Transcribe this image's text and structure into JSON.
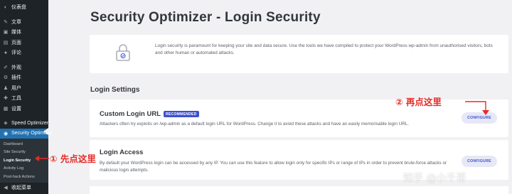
{
  "sidebar": {
    "top_items": [
      {
        "label": "仪表盘",
        "icon": "dashboard-icon"
      },
      {
        "label": "文章",
        "icon": "pin-icon"
      },
      {
        "label": "媒体",
        "icon": "media-icon"
      },
      {
        "label": "页面",
        "icon": "page-icon"
      },
      {
        "label": "评论",
        "icon": "comment-icon"
      }
    ],
    "mid_items": [
      {
        "label": "外观",
        "icon": "brush-icon"
      },
      {
        "label": "插件",
        "icon": "plugin-icon"
      },
      {
        "label": "用户",
        "icon": "user-icon"
      },
      {
        "label": "工具",
        "icon": "wrench-icon"
      },
      {
        "label": "设置",
        "icon": "settings-icon"
      }
    ],
    "speed_optimizer": "Speed Optimizer",
    "security_optimizer": "Security Optimizer",
    "sub_items": [
      "Dashboard",
      "Site Security",
      "Login Security",
      "Activity Log",
      "Post-hack Actions"
    ],
    "collapse": "收起菜单"
  },
  "main": {
    "title": "Security Optimizer - Login Security",
    "intro": "Login security is paramount for keeping your site and data secure. Use the tools we have compiled to protect your WordPress wp-admin from unauthorised visitors, bots and other human or automated attacks.",
    "section_title": "Login Settings",
    "cards": [
      {
        "title": "Custom Login URL",
        "badge": "RECOMMENDED",
        "description": "Attackers often try exploits on /wp-admin as a default login URL for WordPress. Change it to avoid these attacks and have an easily memorisable login URL.",
        "button": "CONFIGURE"
      },
      {
        "title": "Login Access",
        "description": "By default your WordPress login can be accessed by any IP. You can use this feature to allow login only for specific IPs or range of IPs in order to prevent brute-force attacks or malicious login attempts.",
        "button": "CONFIGURE"
      }
    ]
  },
  "annotations": {
    "step1": "① 先点这里",
    "step2": "② 再点这里"
  },
  "watermark": "知乎 @小千哥",
  "colors": {
    "sidebar_bg": "#1d2327",
    "sidebar_active": "#2271b1",
    "accent": "#3e4fce",
    "annotation_red": "#e52d27"
  }
}
